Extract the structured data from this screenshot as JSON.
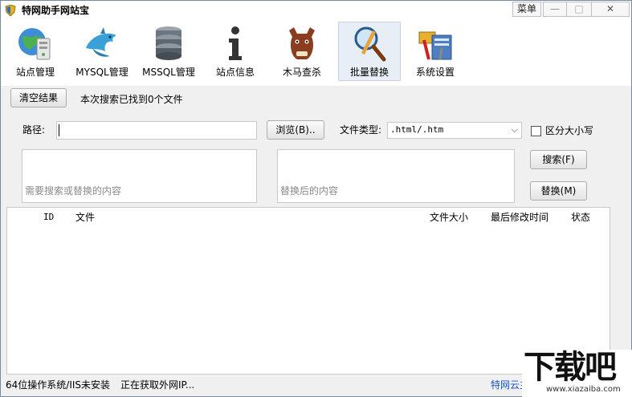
{
  "window": {
    "title": "特网助手网站宝"
  },
  "title_controls": {
    "menu": "菜单",
    "minimize": "—",
    "maximize": "□",
    "close": "✕"
  },
  "toolbar": {
    "items": [
      {
        "label": "站点管理",
        "icon": "globe-server-icon"
      },
      {
        "label": "MYSQL管理",
        "icon": "mysql-dolphin-icon"
      },
      {
        "label": "MSSQL管理",
        "icon": "database-stack-icon"
      },
      {
        "label": "站点信息",
        "icon": "info-icon"
      },
      {
        "label": "木马查杀",
        "icon": "horse-icon"
      },
      {
        "label": "批量替换",
        "icon": "magnifier-icon"
      },
      {
        "label": "系统设置",
        "icon": "settings-tools-icon"
      }
    ],
    "active": "批量替换"
  },
  "search_bar": {
    "clear_label": "清空结果",
    "result_text": "本次搜索已找到0个文件",
    "path_label": "路径:",
    "path_value": "",
    "browse_label": "浏览(B)..",
    "filetype_label": "文件类型:",
    "filetype_value": ".html/.htm",
    "case_label": "区分大小写",
    "case_checked": false
  },
  "search_box": {
    "placeholder": "需要搜索或替换的内容"
  },
  "replace_box": {
    "placeholder": "替换后的内容"
  },
  "actions": {
    "search_label": "搜索(F)",
    "replace_label": "替换(M)"
  },
  "table": {
    "columns": [
      "ID",
      "文件",
      "文件大小",
      "最后修改时间",
      "状态"
    ],
    "rows": []
  },
  "status": {
    "system": "64位操作系统/IIS未安装",
    "ip": "正在获取外网IP...",
    "link": "特网云主"
  },
  "watermark": {
    "text": "下载吧",
    "url": "www.xiazaiba.com"
  }
}
